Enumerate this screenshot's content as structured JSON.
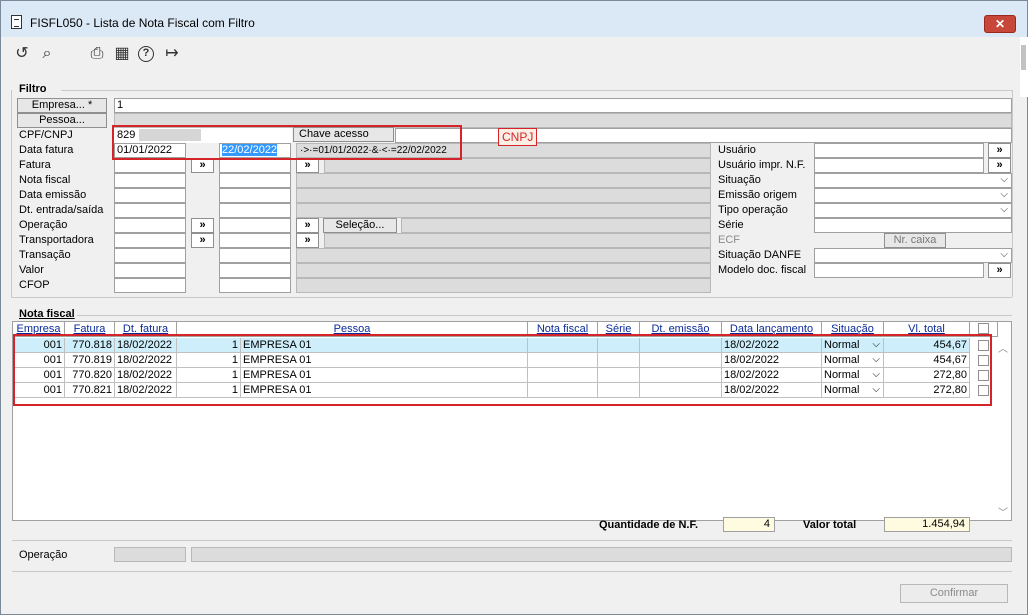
{
  "window": {
    "title": "FISFL050 - Lista de Nota Fiscal com Filtro",
    "close": "✕"
  },
  "toolbar": {
    "undo": "↺",
    "search": "⌕",
    "print": "⎙",
    "calendar": "▦",
    "help": "?",
    "exit": "↦"
  },
  "filtro": {
    "title": "Filtro",
    "empresa_btn": "Empresa... *",
    "empresa_value": "1",
    "pessoa_btn": "Pessoa...",
    "cpf_label": "CPF/CNPJ",
    "cpf_value": "829                    30",
    "chave_btn": "Chave acesso",
    "data_fatura_label": "Data fatura",
    "data_fatura_de": "01/01/2022",
    "data_fatura_ate": "22/02/2022",
    "data_fatura_expr": "·>·=01/01/2022·&·<·=22/02/2022",
    "fatura_label": "Fatura",
    "nota_fiscal_label": "Nota fiscal",
    "data_emissao_label": "Data emissão",
    "dt_entrada_label": "Dt. entrada/saída",
    "operacao_label": "Operação",
    "transportadora_label": "Transportadora",
    "transacao_label": "Transação",
    "valor_label": "Valor",
    "cfop_label": "CFOP",
    "selecao_btn": "Seleção...",
    "arrow": "»",
    "annotation": "CNPJ",
    "usuario_label": "Usuário",
    "usuario_impr_label": "Usuário impr. N.F.",
    "situacao_label": "Situação",
    "emissao_origem_label": "Emissão origem",
    "tipo_operacao_label": "Tipo operação",
    "serie_label": "Série",
    "ecf_label": "ECF",
    "nr_caixa_btn": "Nr. caixa",
    "situacao_danfe_label": "Situação DANFE",
    "modelo_doc_label": "Modelo doc. fiscal",
    "chev": "⌵"
  },
  "nota": {
    "title": "Nota fiscal",
    "columns": [
      "Empresa",
      "Fatura",
      "Dt. fatura",
      "Pessoa",
      "Nota fiscal",
      "Série",
      "Dt. emissão",
      "Data lançamento",
      "Situação",
      "Vl. total"
    ],
    "rows": [
      {
        "empresa": "001",
        "fatura": "770.818",
        "dt_fatura": "18/02/2022",
        "pessoa_cod": "1",
        "pessoa": "EMPRESA 01",
        "nota": "",
        "serie": "",
        "dt_emissao": "",
        "data_lanc": "18/02/2022",
        "situacao": "Normal",
        "vl_total": "454,67"
      },
      {
        "empresa": "001",
        "fatura": "770.819",
        "dt_fatura": "18/02/2022",
        "pessoa_cod": "1",
        "pessoa": "EMPRESA 01",
        "nota": "",
        "serie": "",
        "dt_emissao": "",
        "data_lanc": "18/02/2022",
        "situacao": "Normal",
        "vl_total": "454,67"
      },
      {
        "empresa": "001",
        "fatura": "770.820",
        "dt_fatura": "18/02/2022",
        "pessoa_cod": "1",
        "pessoa": "EMPRESA 01",
        "nota": "",
        "serie": "",
        "dt_emissao": "",
        "data_lanc": "18/02/2022",
        "situacao": "Normal",
        "vl_total": "272,80"
      },
      {
        "empresa": "001",
        "fatura": "770.821",
        "dt_fatura": "18/02/2022",
        "pessoa_cod": "1",
        "pessoa": "EMPRESA 01",
        "nota": "",
        "serie": "",
        "dt_emissao": "",
        "data_lanc": "18/02/2022",
        "situacao": "Normal",
        "vl_total": "272,80"
      }
    ],
    "qtd_label": "Quantidade de N.F.",
    "qtd_value": "4",
    "valor_total_label": "Valor total",
    "valor_total_value": "1.454,94"
  },
  "footer": {
    "operacao_label": "Operação",
    "confirmar": "Confirmar"
  }
}
